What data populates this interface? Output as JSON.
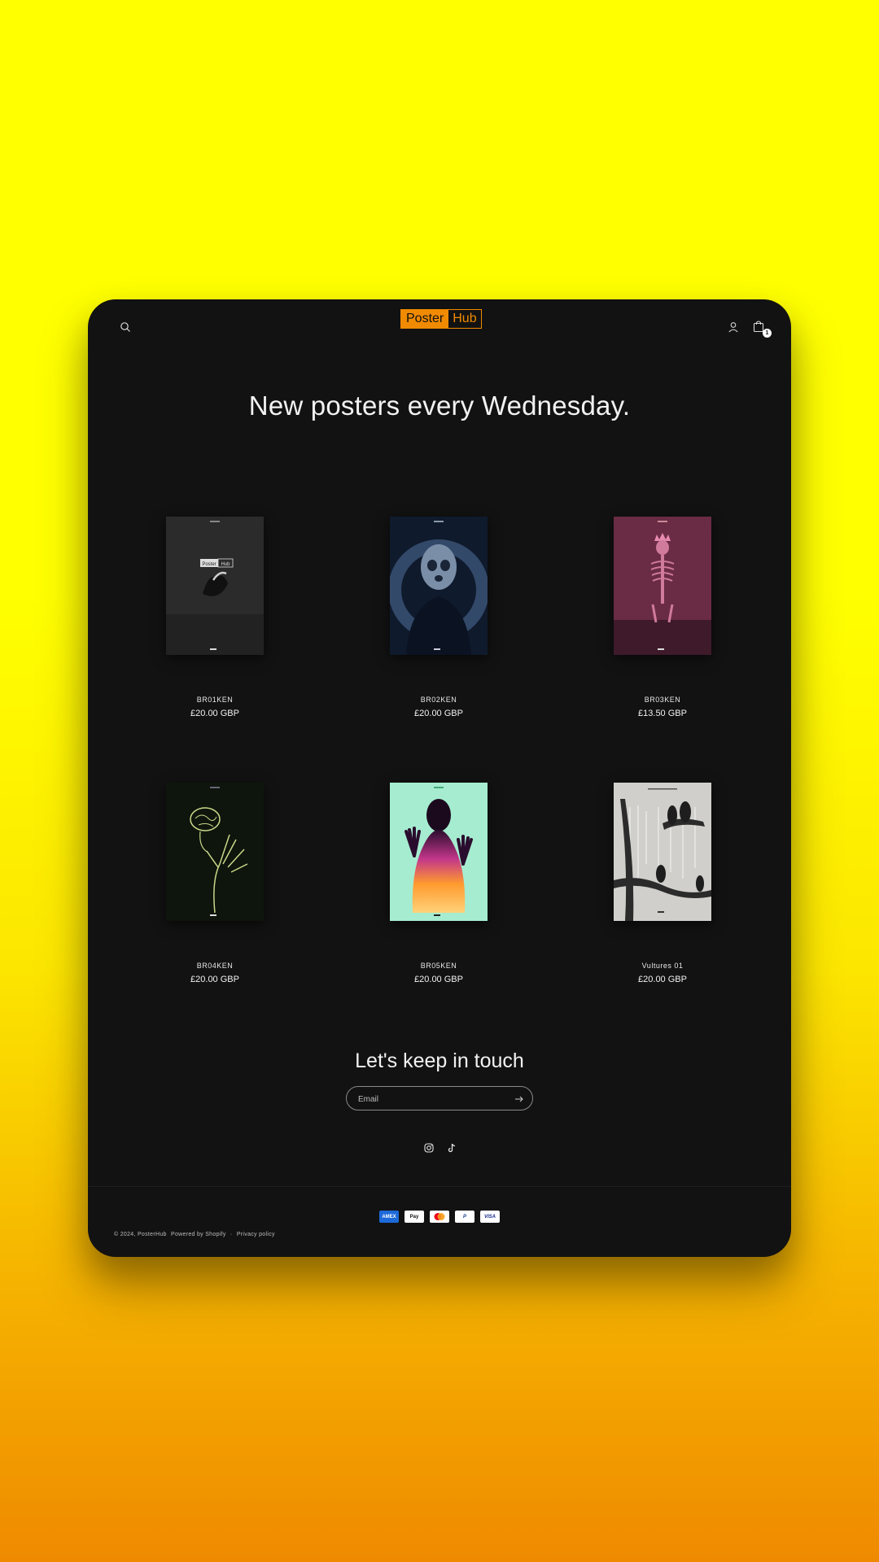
{
  "header": {
    "logo_part1": "Poster",
    "logo_part2": "Hub",
    "cart_count": "1",
    "icons": [
      "search-icon",
      "account-icon",
      "cart-icon"
    ]
  },
  "headline": "New posters every Wednesday.",
  "products": [
    {
      "title": "BR01KEN",
      "price": "£20.00 GBP",
      "poster_bg": "#2b2b2b",
      "poster_logo_part1": "Poster",
      "poster_logo_part2": "Hub"
    },
    {
      "title": "BR02KEN",
      "price": "£20.00 GBP",
      "poster_bg": "#0f1a2c"
    },
    {
      "title": "BR03KEN",
      "price": "£13.50 GBP",
      "poster_bg": "#6a2c44"
    },
    {
      "title": "BR04KEN",
      "price": "£20.00 GBP",
      "poster_bg": "#0e150c"
    },
    {
      "title": "BR05KEN",
      "price": "£20.00 GBP",
      "poster_bg": "#a6ecd0"
    },
    {
      "title": "Vultures 01",
      "price": "£20.00 GBP",
      "poster_bg": "#d0cfcb"
    }
  ],
  "newsletter": {
    "title": "Let's keep in touch",
    "email_placeholder": "Email"
  },
  "social": [
    "instagram-icon",
    "tiktok-icon"
  ],
  "payments": [
    "American Express",
    "Apple Pay",
    "Mastercard",
    "PayPal",
    "Visa"
  ],
  "payment_labels": {
    "amex": "AMEX",
    "apple": " Pay",
    "paypal": "P",
    "visa": "VISA"
  },
  "footer": {
    "copyright": "© 2024, PosterHub",
    "powered": "Powered by Shopify",
    "separator": "·",
    "privacy": "Privacy policy"
  },
  "colors": {
    "accent": "#f08a00",
    "background": "#121212",
    "page_gradient_top": "#ffff00",
    "page_gradient_bottom": "#ef8a00"
  }
}
